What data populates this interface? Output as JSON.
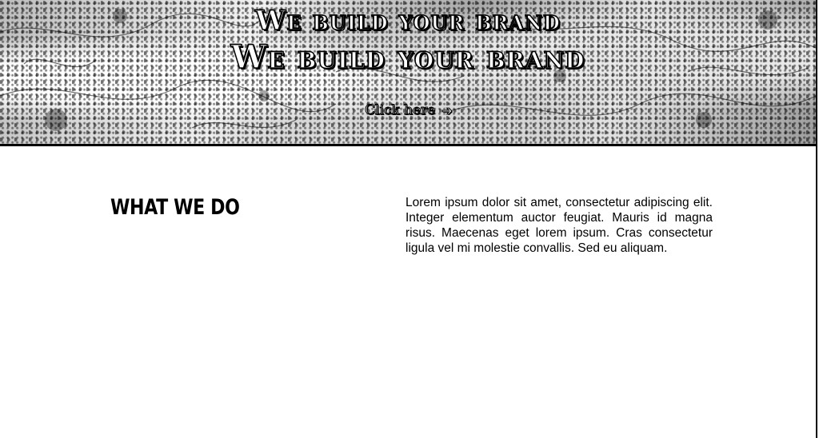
{
  "hero": {
    "headline_primary": "We build your brand",
    "headline_secondary": "We build your brand",
    "cta_label": "Click here",
    "cta_icon": "arrow-right-icon"
  },
  "section": {
    "heading": "WHAT WE DO",
    "body": "Lorem ipsum dolor sit amet, consectetur adipiscing elit. Integer elementum auctor feugiat. Mauris id magna risus. Maecenas eget lorem ipsum. Cras consectetur ligula vel mi molestie convallis. Sed eu aliquam."
  },
  "colors": {
    "page_background": "#ffffff",
    "text": "#000000",
    "hero_text": "#ffffff"
  }
}
